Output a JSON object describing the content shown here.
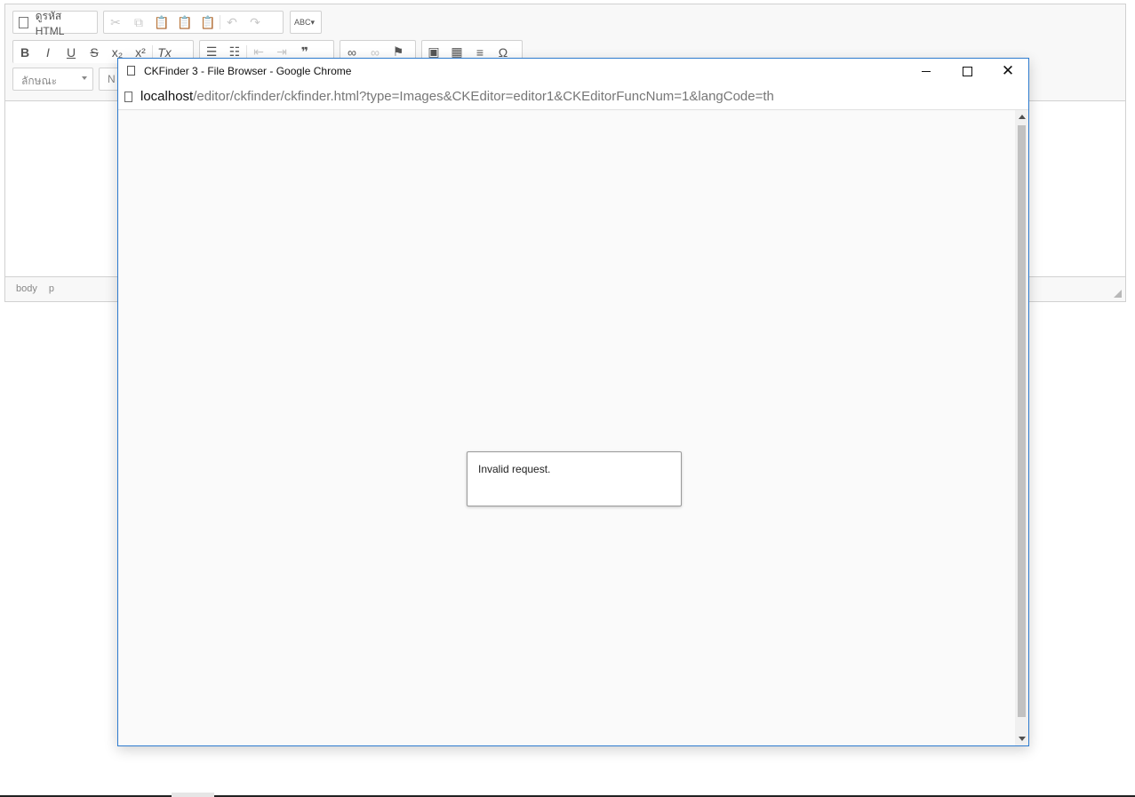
{
  "editor": {
    "source_label": "ดูรหัส HTML",
    "style_combo": "ลักษณะ",
    "format_combo": "N",
    "path": [
      "body",
      "p"
    ],
    "toolbar_row2": {
      "bold": "B",
      "italic": "I",
      "underline": "U",
      "strike": "S",
      "subscript": "x₂",
      "superscript": "x²",
      "remove_format": "Tx",
      "blockquote": "❞",
      "special_char": "Ω"
    }
  },
  "popup": {
    "title": "CKFinder 3 - File Browser - Google Chrome",
    "url_host": "localhost",
    "url_rest": "/editor/ckfinder/ckfinder.html?type=Images&CKEditor=editor1&CKEditorFuncNum=1&langCode=th",
    "message": "Invalid request.",
    "close_glyph": "✕"
  },
  "colors": {
    "window_border": "#2e7bcf",
    "toolbar_bg": "#f8f8f8"
  }
}
